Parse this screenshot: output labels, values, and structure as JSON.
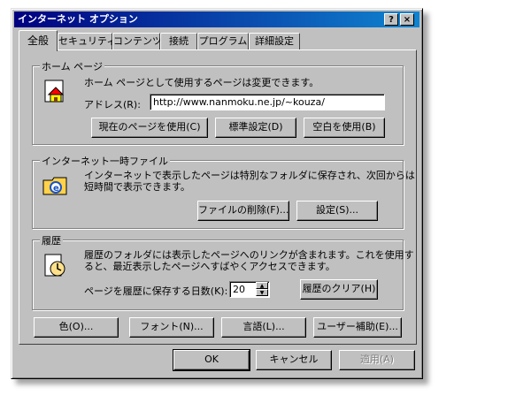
{
  "window": {
    "title": "インターネット オプション",
    "help_button": "?",
    "close_button": "×"
  },
  "tabs": [
    {
      "label": "全般",
      "active": true
    },
    {
      "label": "セキュリティ",
      "active": false
    },
    {
      "label": "コンテンツ",
      "active": false
    },
    {
      "label": "接続",
      "active": false
    },
    {
      "label": "プログラム",
      "active": false
    },
    {
      "label": "詳細設定",
      "active": false
    }
  ],
  "home": {
    "legend": "ホーム ページ",
    "description": "ホーム ページとして使用するページは変更できます。",
    "address_label": "アドレス(R):",
    "address_value": "http://www.nanmoku.ne.jp/~kouza/",
    "use_current": "現在のページを使用(C)",
    "use_default": "標準設定(D)",
    "use_blank": "空白を使用(B)"
  },
  "temp": {
    "legend": "インターネット一時ファイル",
    "description_1": "インターネットで表示したページは特別なフォルダに保存され、次回からは",
    "description_2": "短時間で表示できます。",
    "delete_files": "ファイルの削除(F)...",
    "settings": "設定(S)..."
  },
  "history": {
    "legend": "履歴",
    "description_1": "履歴のフォルダには表示したページへのリンクが含まれます。これを使用す",
    "description_2": "ると、最近表示したページへすばやくアクセスできます。",
    "days_label": "ページを履歴に保存する日数(K):",
    "days_value": "20",
    "clear": "履歴のクリア(H)"
  },
  "bottom_buttons": {
    "colors": "色(O)...",
    "fonts": "フォント(N)...",
    "languages": "言語(L)...",
    "accessibility": "ユーザー補助(E)..."
  },
  "dialog_buttons": {
    "ok": "OK",
    "cancel": "キャンセル",
    "apply": "適用(A)"
  },
  "colors": {
    "title_start": "#000080",
    "title_end": "#1084d0",
    "face": "#c0c0c0"
  }
}
